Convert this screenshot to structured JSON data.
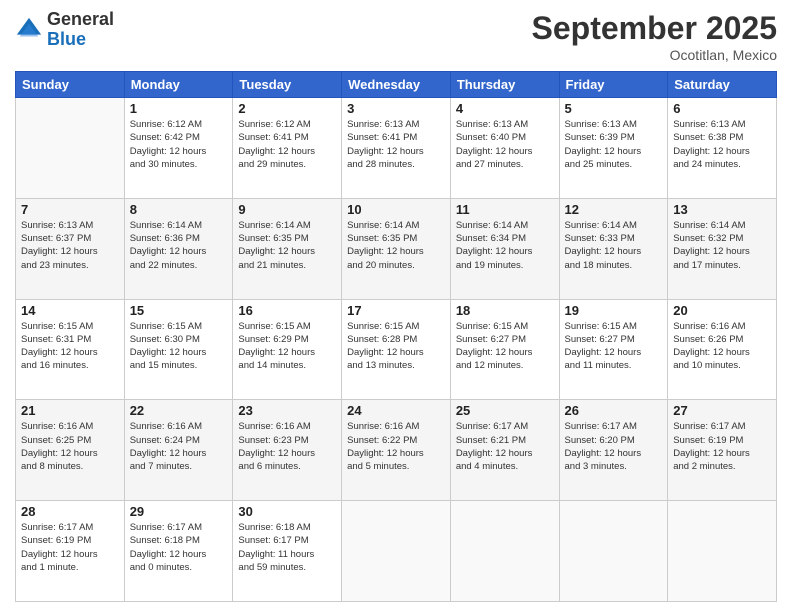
{
  "logo": {
    "general": "General",
    "blue": "Blue"
  },
  "header": {
    "month": "September 2025",
    "location": "Ocotitlan, Mexico"
  },
  "weekdays": [
    "Sunday",
    "Monday",
    "Tuesday",
    "Wednesday",
    "Thursday",
    "Friday",
    "Saturday"
  ],
  "weeks": [
    [
      {
        "day": "",
        "info": ""
      },
      {
        "day": "1",
        "info": "Sunrise: 6:12 AM\nSunset: 6:42 PM\nDaylight: 12 hours\nand 30 minutes."
      },
      {
        "day": "2",
        "info": "Sunrise: 6:12 AM\nSunset: 6:41 PM\nDaylight: 12 hours\nand 29 minutes."
      },
      {
        "day": "3",
        "info": "Sunrise: 6:13 AM\nSunset: 6:41 PM\nDaylight: 12 hours\nand 28 minutes."
      },
      {
        "day": "4",
        "info": "Sunrise: 6:13 AM\nSunset: 6:40 PM\nDaylight: 12 hours\nand 27 minutes."
      },
      {
        "day": "5",
        "info": "Sunrise: 6:13 AM\nSunset: 6:39 PM\nDaylight: 12 hours\nand 25 minutes."
      },
      {
        "day": "6",
        "info": "Sunrise: 6:13 AM\nSunset: 6:38 PM\nDaylight: 12 hours\nand 24 minutes."
      }
    ],
    [
      {
        "day": "7",
        "info": "Sunrise: 6:13 AM\nSunset: 6:37 PM\nDaylight: 12 hours\nand 23 minutes."
      },
      {
        "day": "8",
        "info": "Sunrise: 6:14 AM\nSunset: 6:36 PM\nDaylight: 12 hours\nand 22 minutes."
      },
      {
        "day": "9",
        "info": "Sunrise: 6:14 AM\nSunset: 6:35 PM\nDaylight: 12 hours\nand 21 minutes."
      },
      {
        "day": "10",
        "info": "Sunrise: 6:14 AM\nSunset: 6:35 PM\nDaylight: 12 hours\nand 20 minutes."
      },
      {
        "day": "11",
        "info": "Sunrise: 6:14 AM\nSunset: 6:34 PM\nDaylight: 12 hours\nand 19 minutes."
      },
      {
        "day": "12",
        "info": "Sunrise: 6:14 AM\nSunset: 6:33 PM\nDaylight: 12 hours\nand 18 minutes."
      },
      {
        "day": "13",
        "info": "Sunrise: 6:14 AM\nSunset: 6:32 PM\nDaylight: 12 hours\nand 17 minutes."
      }
    ],
    [
      {
        "day": "14",
        "info": "Sunrise: 6:15 AM\nSunset: 6:31 PM\nDaylight: 12 hours\nand 16 minutes."
      },
      {
        "day": "15",
        "info": "Sunrise: 6:15 AM\nSunset: 6:30 PM\nDaylight: 12 hours\nand 15 minutes."
      },
      {
        "day": "16",
        "info": "Sunrise: 6:15 AM\nSunset: 6:29 PM\nDaylight: 12 hours\nand 14 minutes."
      },
      {
        "day": "17",
        "info": "Sunrise: 6:15 AM\nSunset: 6:28 PM\nDaylight: 12 hours\nand 13 minutes."
      },
      {
        "day": "18",
        "info": "Sunrise: 6:15 AM\nSunset: 6:27 PM\nDaylight: 12 hours\nand 12 minutes."
      },
      {
        "day": "19",
        "info": "Sunrise: 6:15 AM\nSunset: 6:27 PM\nDaylight: 12 hours\nand 11 minutes."
      },
      {
        "day": "20",
        "info": "Sunrise: 6:16 AM\nSunset: 6:26 PM\nDaylight: 12 hours\nand 10 minutes."
      }
    ],
    [
      {
        "day": "21",
        "info": "Sunrise: 6:16 AM\nSunset: 6:25 PM\nDaylight: 12 hours\nand 8 minutes."
      },
      {
        "day": "22",
        "info": "Sunrise: 6:16 AM\nSunset: 6:24 PM\nDaylight: 12 hours\nand 7 minutes."
      },
      {
        "day": "23",
        "info": "Sunrise: 6:16 AM\nSunset: 6:23 PM\nDaylight: 12 hours\nand 6 minutes."
      },
      {
        "day": "24",
        "info": "Sunrise: 6:16 AM\nSunset: 6:22 PM\nDaylight: 12 hours\nand 5 minutes."
      },
      {
        "day": "25",
        "info": "Sunrise: 6:17 AM\nSunset: 6:21 PM\nDaylight: 12 hours\nand 4 minutes."
      },
      {
        "day": "26",
        "info": "Sunrise: 6:17 AM\nSunset: 6:20 PM\nDaylight: 12 hours\nand 3 minutes."
      },
      {
        "day": "27",
        "info": "Sunrise: 6:17 AM\nSunset: 6:19 PM\nDaylight: 12 hours\nand 2 minutes."
      }
    ],
    [
      {
        "day": "28",
        "info": "Sunrise: 6:17 AM\nSunset: 6:19 PM\nDaylight: 12 hours\nand 1 minute."
      },
      {
        "day": "29",
        "info": "Sunrise: 6:17 AM\nSunset: 6:18 PM\nDaylight: 12 hours\nand 0 minutes."
      },
      {
        "day": "30",
        "info": "Sunrise: 6:18 AM\nSunset: 6:17 PM\nDaylight: 11 hours\nand 59 minutes."
      },
      {
        "day": "",
        "info": ""
      },
      {
        "day": "",
        "info": ""
      },
      {
        "day": "",
        "info": ""
      },
      {
        "day": "",
        "info": ""
      }
    ]
  ]
}
